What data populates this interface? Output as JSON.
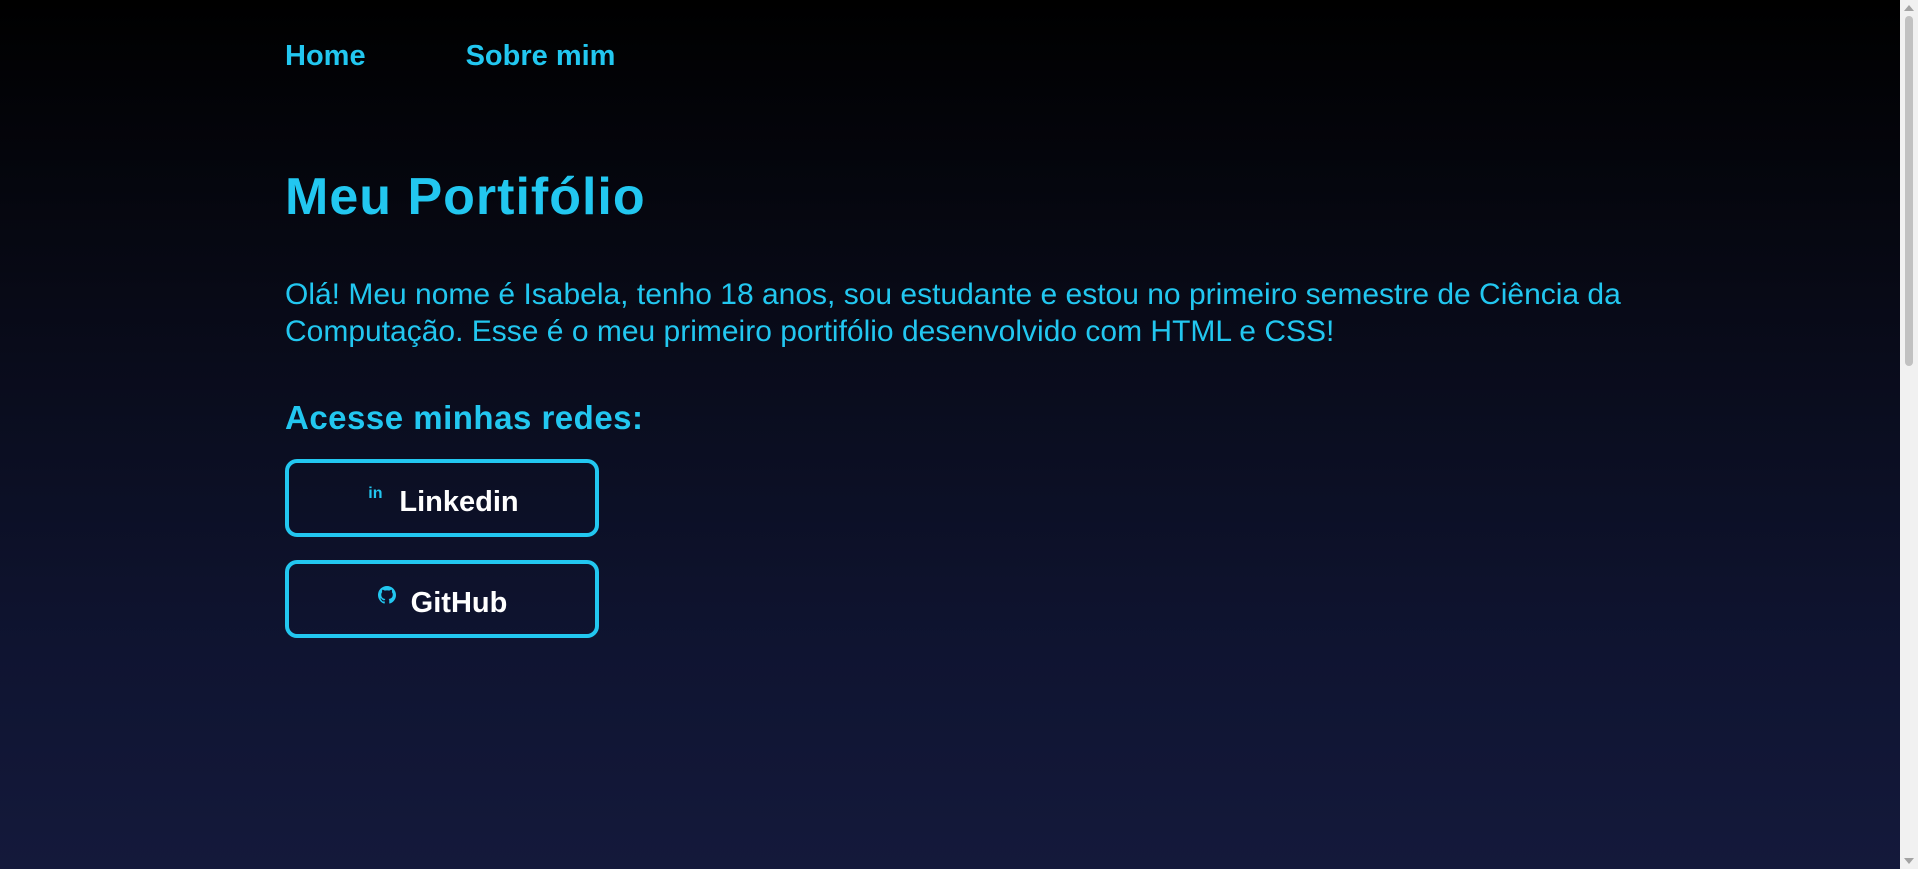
{
  "nav": {
    "items": [
      {
        "label": "Home"
      },
      {
        "label": "Sobre mim"
      }
    ]
  },
  "main": {
    "title": "Meu Portifólio",
    "intro": "Olá! Meu nome é Isabela, tenho 18 anos, sou estudante e estou no primeiro semestre de Ciência da Computação. Esse é o meu primeiro portifólio desenvolvido com HTML e CSS!",
    "networks_heading": "Acesse minhas redes:",
    "social_links": [
      {
        "label": "Linkedin",
        "icon": "linkedin-icon",
        "icon_text": "in"
      },
      {
        "label": "GitHub",
        "icon": "github-icon"
      }
    ]
  },
  "colors": {
    "accent": "#22c7f0",
    "button_text": "#ffffff",
    "background_top": "#000000",
    "background_bottom": "#14193b"
  }
}
